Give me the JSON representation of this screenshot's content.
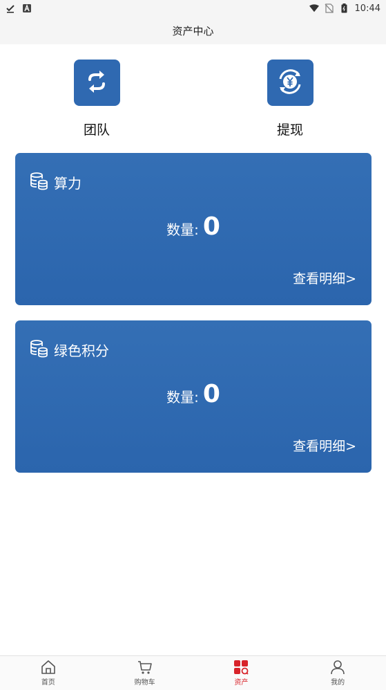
{
  "statusbar": {
    "time": "10:44"
  },
  "header": {
    "title": "资产中心"
  },
  "actions": [
    {
      "label": "团队"
    },
    {
      "label": "提现"
    }
  ],
  "cards": [
    {
      "title": "算力",
      "qty_label": "数量:",
      "qty_value": "0",
      "more": "查看明细>"
    },
    {
      "title": "绿色积分",
      "qty_label": "数量:",
      "qty_value": "0",
      "more": "查看明细>"
    }
  ],
  "tabbar": [
    {
      "label": "首页",
      "icon": "home-icon"
    },
    {
      "label": "购物车",
      "icon": "cart-icon"
    },
    {
      "label": "资产",
      "icon": "assets-icon",
      "active": true
    },
    {
      "label": "我的",
      "icon": "user-icon"
    }
  ],
  "colors": {
    "primary": "#2f69b1",
    "active_tab": "#d8232a"
  }
}
